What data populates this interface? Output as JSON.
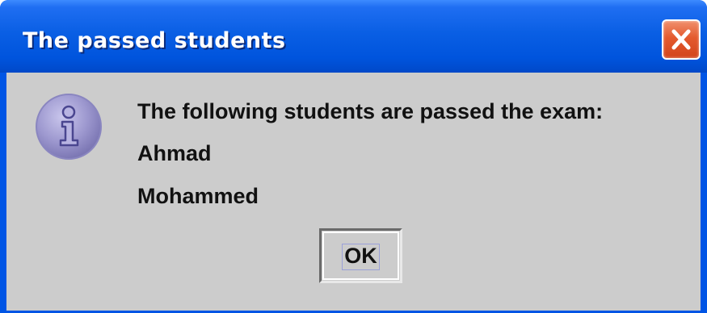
{
  "window": {
    "title": "The passed students",
    "title_color": "#ffffff",
    "titlebar_color": "#0054dd",
    "close_button_color": "#e45a2e"
  },
  "dialog": {
    "icon": "info-icon",
    "message_lines": [
      "The following students are passed the exam:",
      "Ahmad",
      "Mohammed"
    ],
    "background_color": "#cccccc"
  },
  "buttons": {
    "ok_label": "OK"
  }
}
